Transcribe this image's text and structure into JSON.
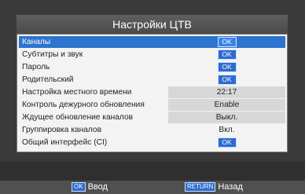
{
  "title": "Настройки ЦТВ",
  "menu": {
    "items": [
      {
        "label": "Каналы",
        "value": "OK",
        "type": "ok",
        "selected": true
      },
      {
        "label": "Субтитры и звук",
        "value": "OK",
        "type": "ok",
        "selected": false
      },
      {
        "label": "Пароль",
        "value": "OK",
        "type": "ok",
        "selected": false
      },
      {
        "label": "Родительский",
        "value": "OK",
        "type": "ok",
        "selected": false
      },
      {
        "label": "Настройка местного времени",
        "value": "22:17",
        "type": "text",
        "selected": false
      },
      {
        "label": "Контроль дежурного обновления",
        "value": "Enable",
        "type": "text",
        "selected": false
      },
      {
        "label": "Ждущее обновление каналов",
        "value": "Выкл.",
        "type": "text",
        "selected": false
      },
      {
        "label": "Группировка каналов",
        "value": "Вкл.",
        "type": "text",
        "selected": false
      },
      {
        "label": "Общий интерфейс (CI)",
        "value": "OK",
        "type": "ok",
        "selected": false
      }
    ]
  },
  "footer": {
    "enter_key": "OK",
    "enter_label": "Ввод",
    "back_key": "RETURN",
    "back_label": "Назад"
  },
  "colors": {
    "selection": "#2d74cf",
    "ok_badge": "#2d6bd1",
    "panel": "#f3f3f3",
    "value_shade": "#d7d7d7"
  }
}
